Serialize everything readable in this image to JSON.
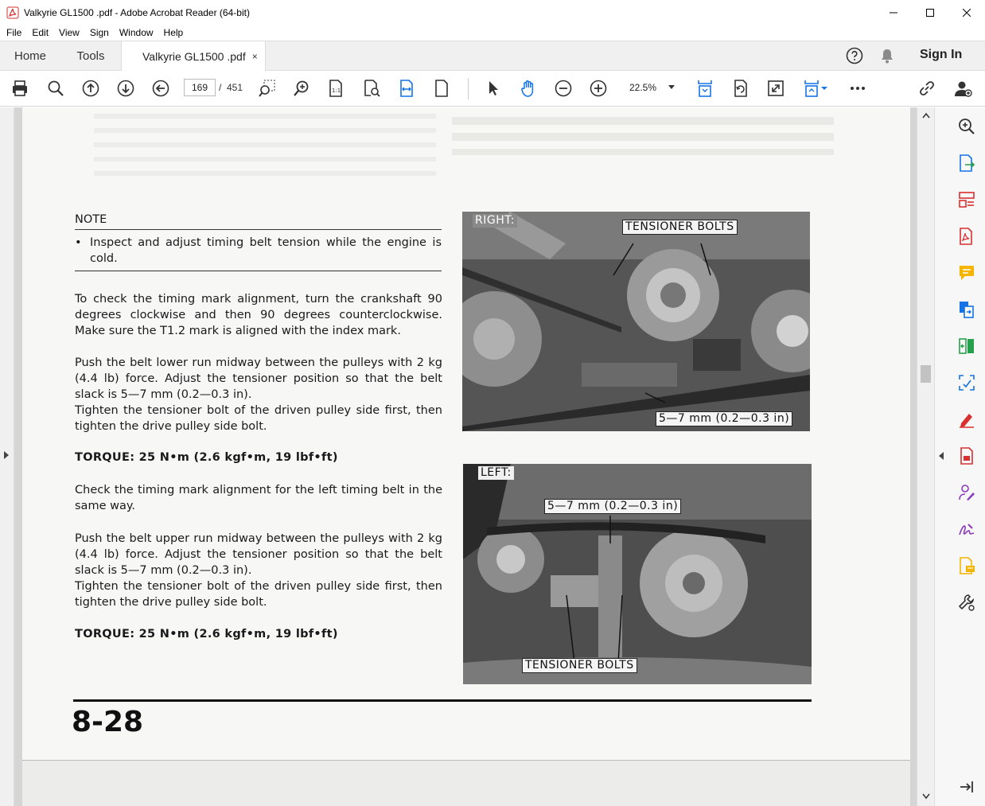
{
  "window": {
    "title": "Valkyrie GL1500 .pdf - Adobe Acrobat Reader (64-bit)",
    "controls": [
      "minimize-icon",
      "maximize-icon",
      "close-icon"
    ]
  },
  "menu": {
    "items": [
      {
        "label": "File"
      },
      {
        "label": "Edit"
      },
      {
        "label": "View"
      },
      {
        "label": "Sign"
      },
      {
        "label": "Window"
      },
      {
        "label": "Help"
      }
    ]
  },
  "tabs": {
    "home": "Home",
    "tools": "Tools",
    "document": "Valkyrie GL1500 .pdf",
    "close": "×",
    "sign_in": "Sign In"
  },
  "toolbar": {
    "current_page": "169",
    "separator": "/",
    "total_pages": "451",
    "zoom": "22.5%"
  },
  "document": {
    "note_heading": "NOTE",
    "note_bullet": "•",
    "note_text": "Inspect and adjust timing belt tension while the engine is cold.",
    "para1": "To check the timing mark alignment, turn the crankshaft 90 degrees clockwise and then 90 degrees counterclockwise. Make sure the T1.2 mark is aligned with the index mark.",
    "para2a": "Push the belt lower run midway between the pulleys with 2 kg (4.4 lb) force. Adjust the tensioner position so that the belt slack is 5—7 mm (0.2—0.3 in).",
    "para2b": "Tighten the tensioner bolt of the driven pulley side first, then tighten the drive pulley side bolt.",
    "torque1": "TORQUE: 25 N•m (2.6 kgf•m, 19 lbf•ft)",
    "para3": "Check the timing mark alignment for the left timing belt in the same way.",
    "para4a": "Push the belt upper run midway between the pulleys with 2 kg (4.4 lb) force. Adjust the tensioner position so that the belt slack is 5—7 mm (0.2—0.3 in).",
    "para4b": "Tighten the tensioner bolt of the driven pulley side first, then tighten the drive pulley side bolt.",
    "torque2": "TORQUE: 25 N•m (2.6 kgf•m, 19 lbf•ft)",
    "photo_right": {
      "side_label": "RIGHT:",
      "bolts_label": "TENSIONER BOLTS",
      "slack_label": "5—7 mm (0.2—0.3 in)"
    },
    "photo_left": {
      "side_label": "LEFT:",
      "slack_label": "5—7 mm (0.2—0.3 in)",
      "bolts_label": "TENSIONER BOLTS"
    },
    "page_number": "8-28"
  }
}
